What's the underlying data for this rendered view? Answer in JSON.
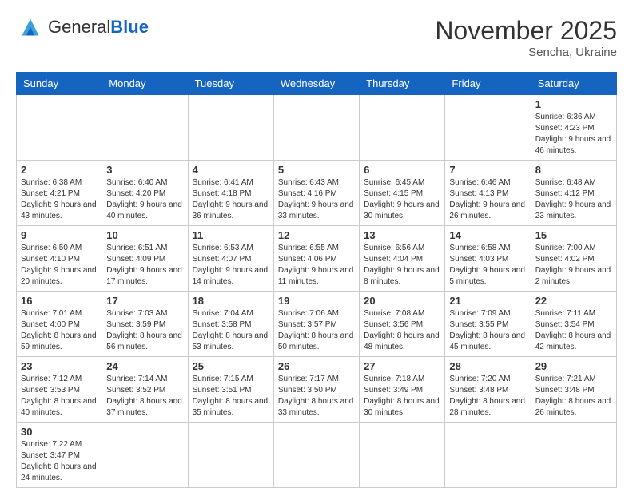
{
  "header": {
    "logo_general": "General",
    "logo_blue": "Blue",
    "month_year": "November 2025",
    "location": "Sencha, Ukraine"
  },
  "weekdays": [
    "Sunday",
    "Monday",
    "Tuesday",
    "Wednesday",
    "Thursday",
    "Friday",
    "Saturday"
  ],
  "weeks": [
    [
      {
        "day": "",
        "info": ""
      },
      {
        "day": "",
        "info": ""
      },
      {
        "day": "",
        "info": ""
      },
      {
        "day": "",
        "info": ""
      },
      {
        "day": "",
        "info": ""
      },
      {
        "day": "",
        "info": ""
      },
      {
        "day": "1",
        "info": "Sunrise: 6:36 AM\nSunset: 4:23 PM\nDaylight: 9 hours and 46 minutes."
      }
    ],
    [
      {
        "day": "2",
        "info": "Sunrise: 6:38 AM\nSunset: 4:21 PM\nDaylight: 9 hours and 43 minutes."
      },
      {
        "day": "3",
        "info": "Sunrise: 6:40 AM\nSunset: 4:20 PM\nDaylight: 9 hours and 40 minutes."
      },
      {
        "day": "4",
        "info": "Sunrise: 6:41 AM\nSunset: 4:18 PM\nDaylight: 9 hours and 36 minutes."
      },
      {
        "day": "5",
        "info": "Sunrise: 6:43 AM\nSunset: 4:16 PM\nDaylight: 9 hours and 33 minutes."
      },
      {
        "day": "6",
        "info": "Sunrise: 6:45 AM\nSunset: 4:15 PM\nDaylight: 9 hours and 30 minutes."
      },
      {
        "day": "7",
        "info": "Sunrise: 6:46 AM\nSunset: 4:13 PM\nDaylight: 9 hours and 26 minutes."
      },
      {
        "day": "8",
        "info": "Sunrise: 6:48 AM\nSunset: 4:12 PM\nDaylight: 9 hours and 23 minutes."
      }
    ],
    [
      {
        "day": "9",
        "info": "Sunrise: 6:50 AM\nSunset: 4:10 PM\nDaylight: 9 hours and 20 minutes."
      },
      {
        "day": "10",
        "info": "Sunrise: 6:51 AM\nSunset: 4:09 PM\nDaylight: 9 hours and 17 minutes."
      },
      {
        "day": "11",
        "info": "Sunrise: 6:53 AM\nSunset: 4:07 PM\nDaylight: 9 hours and 14 minutes."
      },
      {
        "day": "12",
        "info": "Sunrise: 6:55 AM\nSunset: 4:06 PM\nDaylight: 9 hours and 11 minutes."
      },
      {
        "day": "13",
        "info": "Sunrise: 6:56 AM\nSunset: 4:04 PM\nDaylight: 9 hours and 8 minutes."
      },
      {
        "day": "14",
        "info": "Sunrise: 6:58 AM\nSunset: 4:03 PM\nDaylight: 9 hours and 5 minutes."
      },
      {
        "day": "15",
        "info": "Sunrise: 7:00 AM\nSunset: 4:02 PM\nDaylight: 9 hours and 2 minutes."
      }
    ],
    [
      {
        "day": "16",
        "info": "Sunrise: 7:01 AM\nSunset: 4:00 PM\nDaylight: 8 hours and 59 minutes."
      },
      {
        "day": "17",
        "info": "Sunrise: 7:03 AM\nSunset: 3:59 PM\nDaylight: 8 hours and 56 minutes."
      },
      {
        "day": "18",
        "info": "Sunrise: 7:04 AM\nSunset: 3:58 PM\nDaylight: 8 hours and 53 minutes."
      },
      {
        "day": "19",
        "info": "Sunrise: 7:06 AM\nSunset: 3:57 PM\nDaylight: 8 hours and 50 minutes."
      },
      {
        "day": "20",
        "info": "Sunrise: 7:08 AM\nSunset: 3:56 PM\nDaylight: 8 hours and 48 minutes."
      },
      {
        "day": "21",
        "info": "Sunrise: 7:09 AM\nSunset: 3:55 PM\nDaylight: 8 hours and 45 minutes."
      },
      {
        "day": "22",
        "info": "Sunrise: 7:11 AM\nSunset: 3:54 PM\nDaylight: 8 hours and 42 minutes."
      }
    ],
    [
      {
        "day": "23",
        "info": "Sunrise: 7:12 AM\nSunset: 3:53 PM\nDaylight: 8 hours and 40 minutes."
      },
      {
        "day": "24",
        "info": "Sunrise: 7:14 AM\nSunset: 3:52 PM\nDaylight: 8 hours and 37 minutes."
      },
      {
        "day": "25",
        "info": "Sunrise: 7:15 AM\nSunset: 3:51 PM\nDaylight: 8 hours and 35 minutes."
      },
      {
        "day": "26",
        "info": "Sunrise: 7:17 AM\nSunset: 3:50 PM\nDaylight: 8 hours and 33 minutes."
      },
      {
        "day": "27",
        "info": "Sunrise: 7:18 AM\nSunset: 3:49 PM\nDaylight: 8 hours and 30 minutes."
      },
      {
        "day": "28",
        "info": "Sunrise: 7:20 AM\nSunset: 3:48 PM\nDaylight: 8 hours and 28 minutes."
      },
      {
        "day": "29",
        "info": "Sunrise: 7:21 AM\nSunset: 3:48 PM\nDaylight: 8 hours and 26 minutes."
      }
    ],
    [
      {
        "day": "30",
        "info": "Sunrise: 7:22 AM\nSunset: 3:47 PM\nDaylight: 8 hours and 24 minutes."
      },
      {
        "day": "",
        "info": ""
      },
      {
        "day": "",
        "info": ""
      },
      {
        "day": "",
        "info": ""
      },
      {
        "day": "",
        "info": ""
      },
      {
        "day": "",
        "info": ""
      },
      {
        "day": "",
        "info": ""
      }
    ]
  ]
}
